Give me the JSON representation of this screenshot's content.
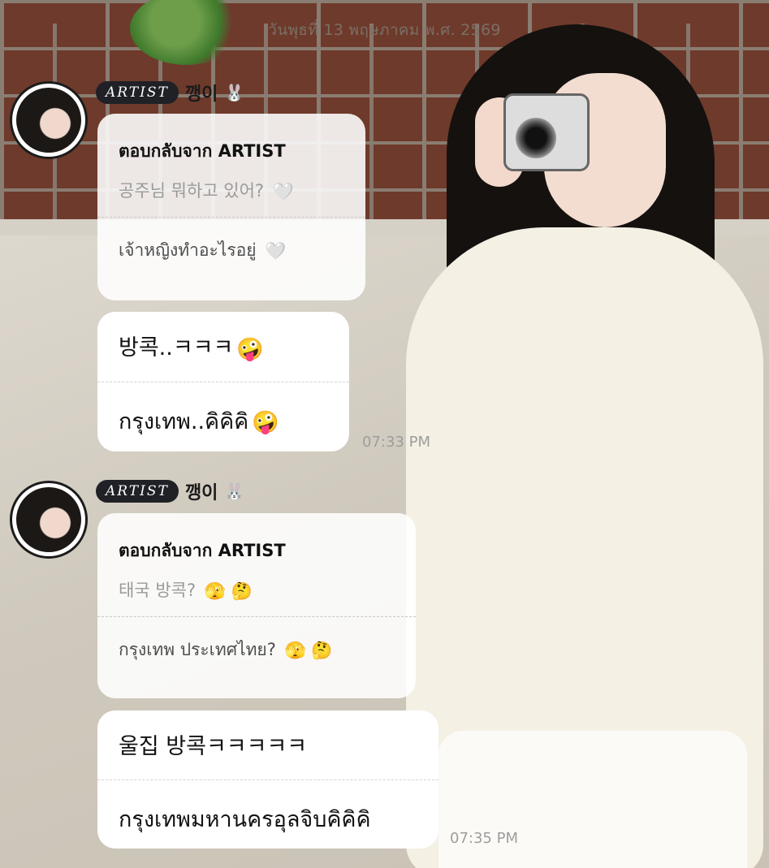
{
  "date_header": "วันพุธที่ 13 พฤษภาคม พ.ศ. 2569",
  "messages": [
    {
      "badge": "ARTIST",
      "sender": "깽이",
      "sender_emoji": "🐰",
      "reply_heading": "ตอบกลับจาก ARTIST",
      "quoted_original": "공주님 뭐하고 있어?",
      "quoted_original_emoji": "🤍",
      "quoted_translation": "เจ้าหญิงทำอะไรอยู่",
      "quoted_translation_emoji": "🤍",
      "text_original": "방콕..ㅋㅋㅋ",
      "text_original_emoji": "🤪",
      "text_translation": "กรุงเทพ..คิคิคิ",
      "text_translation_emoji": "🤪",
      "time": "07:33 PM"
    },
    {
      "badge": "ARTIST",
      "sender": "깽이",
      "sender_emoji": "🐰",
      "reply_heading": "ตอบกลับจาก ARTIST",
      "quoted_original": "태국 방콕?",
      "quoted_original_emoji": "🫣 🤔",
      "quoted_translation": "กรุงเทพ ประเทศไทย?",
      "quoted_translation_emoji": "🫣 🤔",
      "text_original": "울집 방콕ㅋㅋㅋㅋㅋ",
      "text_original_emoji": "",
      "text_translation": "กรุงเทพมหานครอุลจิบคิคิคิ",
      "text_translation_emoji": "",
      "time": "07:35 PM"
    }
  ]
}
